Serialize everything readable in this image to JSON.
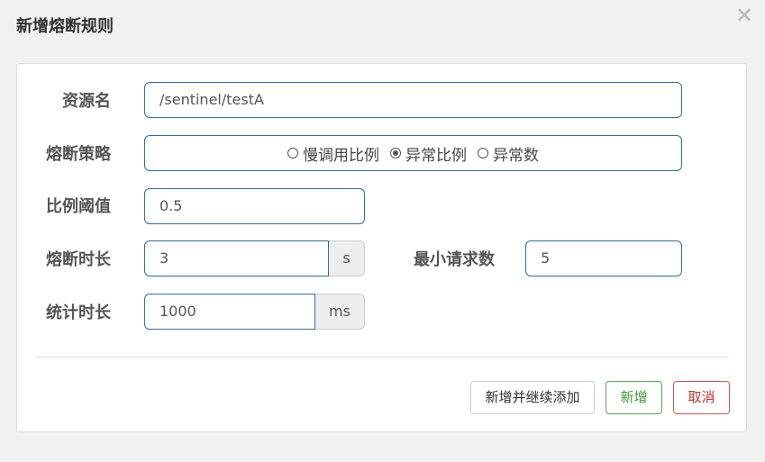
{
  "dialog": {
    "title": "新增熔断规则",
    "close_label": "×"
  },
  "form": {
    "resource": {
      "label": "资源名",
      "value": "/sentinel/testA"
    },
    "strategy": {
      "label": "熔断策略",
      "options": [
        {
          "label": "慢调用比例",
          "checked": false
        },
        {
          "label": "异常比例",
          "checked": true
        },
        {
          "label": "异常数",
          "checked": false
        }
      ]
    },
    "ratio": {
      "label": "比例阈值",
      "value": "0.5"
    },
    "break_duration": {
      "label": "熔断时长",
      "value": "3",
      "unit": "s"
    },
    "min_requests": {
      "label": "最小请求数",
      "value": "5"
    },
    "stat_duration": {
      "label": "统计时长",
      "value": "1000",
      "unit": "ms"
    }
  },
  "footer": {
    "add_continue_label": "新增并继续添加",
    "add_label": "新增",
    "cancel_label": "取消"
  }
}
